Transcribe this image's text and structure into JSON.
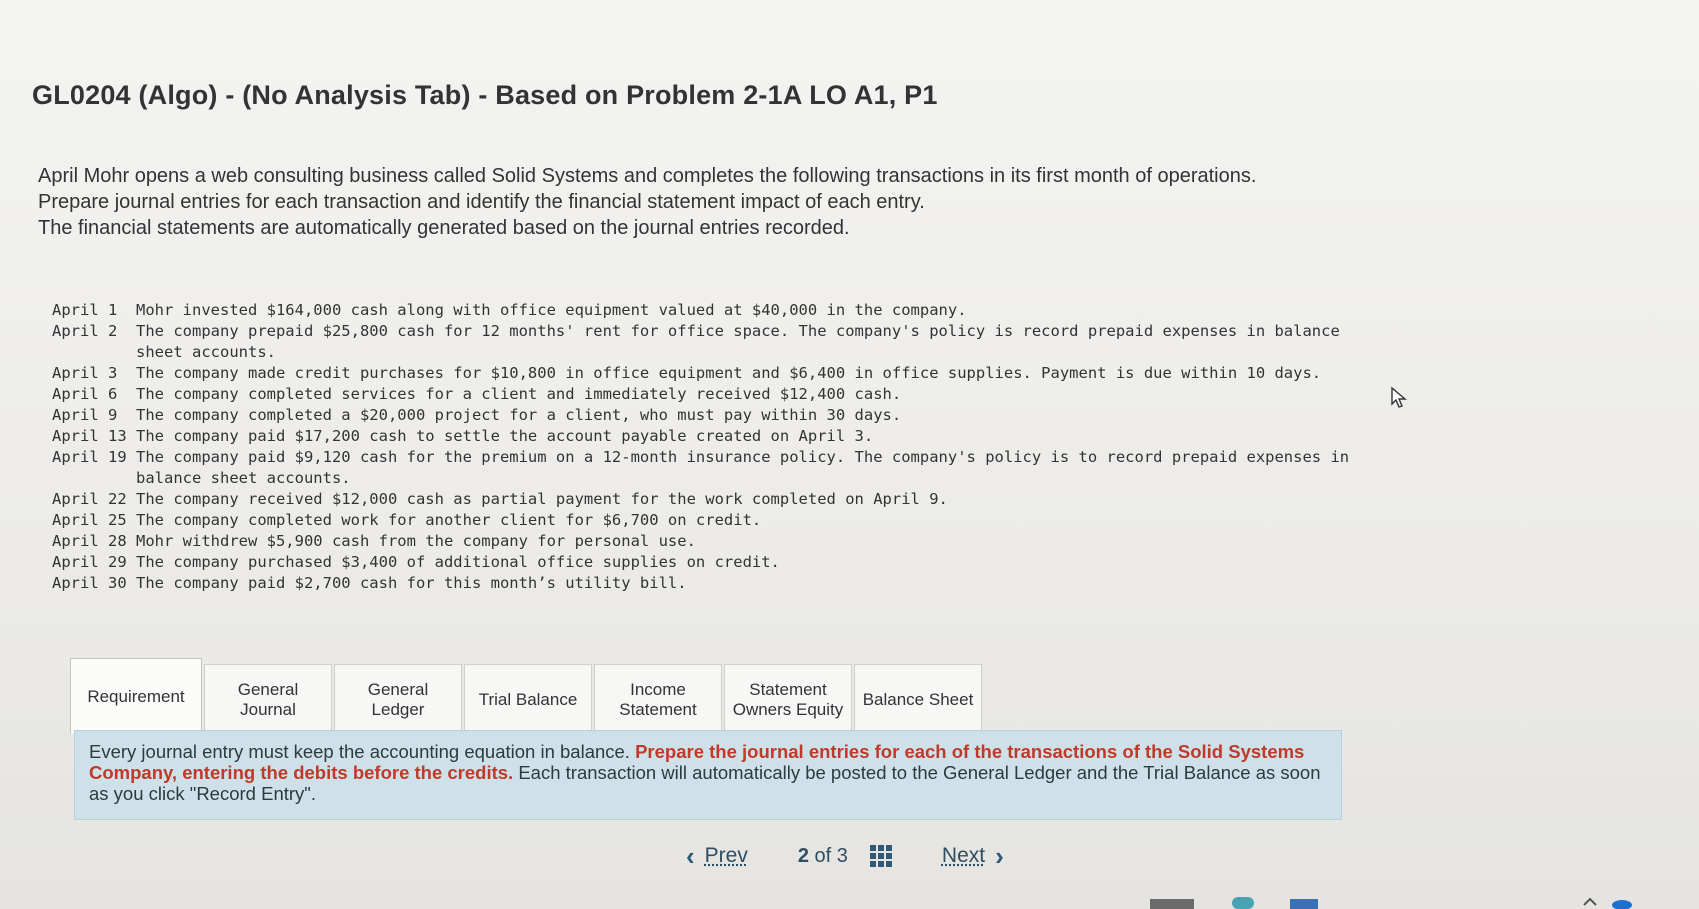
{
  "title": "GL0204 (Algo) - (No Analysis Tab) - Based on Problem 2-1A LO A1, P1",
  "intro": [
    "April Mohr opens a web consulting business called Solid Systems and completes the following transactions in its first month of operations.",
    "Prepare journal entries for each transaction and identify the financial statement impact of each entry.",
    "The financial statements are automatically generated based on the journal entries recorded."
  ],
  "transactions": [
    {
      "date": "April 1",
      "text": "Mohr invested $164,000 cash along with office equipment valued at $40,000 in the company."
    },
    {
      "date": "April 2",
      "text": "The company prepaid $25,800 cash for 12 months' rent for office space. The company's policy is record prepaid expenses in balance sheet accounts."
    },
    {
      "date": "April 3",
      "text": "The company made credit purchases for $10,800 in office equipment and $6,400 in office supplies. Payment is due within 10 days."
    },
    {
      "date": "April 6",
      "text": "The company completed services for a client and immediately received $12,400 cash."
    },
    {
      "date": "April 9",
      "text": "The company completed a $20,000 project for a client, who must pay within 30 days."
    },
    {
      "date": "April 13",
      "text": "The company paid $17,200 cash to settle the account payable created on April 3."
    },
    {
      "date": "April 19",
      "text": "The company paid $9,120 cash for the premium on a 12-month insurance policy. The company's policy is to record prepaid expenses in balance sheet accounts."
    },
    {
      "date": "April 22",
      "text": "The company received $12,000 cash as partial payment for the work completed on April 9."
    },
    {
      "date": "April 25",
      "text": "The company completed work for another client for $6,700 on credit."
    },
    {
      "date": "April 28",
      "text": "Mohr withdrew $5,900 cash from the company for personal use."
    },
    {
      "date": "April 29",
      "text": "The company purchased $3,400 of additional office supplies on credit."
    },
    {
      "date": "April 30",
      "text": "The company paid $2,700 cash for this month’s utility bill."
    }
  ],
  "tabs": [
    {
      "label": "Requirement"
    },
    {
      "label": "General Journal"
    },
    {
      "label": "General Ledger"
    },
    {
      "label": "Trial Balance"
    },
    {
      "label": "Income Statement"
    },
    {
      "label": "Statement Owners Equity"
    },
    {
      "label": "Balance Sheet"
    }
  ],
  "instruction": {
    "part1": "Every journal entry must keep the accounting equation in balance. ",
    "part2": "Prepare the journal entries for each of the transactions of the Solid Systems Company, entering the debits before the credits.",
    "part3": " Each transaction will automatically be posted to the General Ledger and the Trial Balance as soon as you click \"Record Entry\"."
  },
  "pager": {
    "prev": "Prev",
    "current": "2",
    "of": "of 3",
    "next": "Next"
  },
  "colors": {
    "accent": "#2e5a7a",
    "emphasis": "#c0392b",
    "instruction_bg": "#cfe1e8"
  },
  "icons": [
    "chevron-left-icon",
    "grid-icon",
    "chevron-right-icon",
    "mouse-cursor-icon"
  ]
}
